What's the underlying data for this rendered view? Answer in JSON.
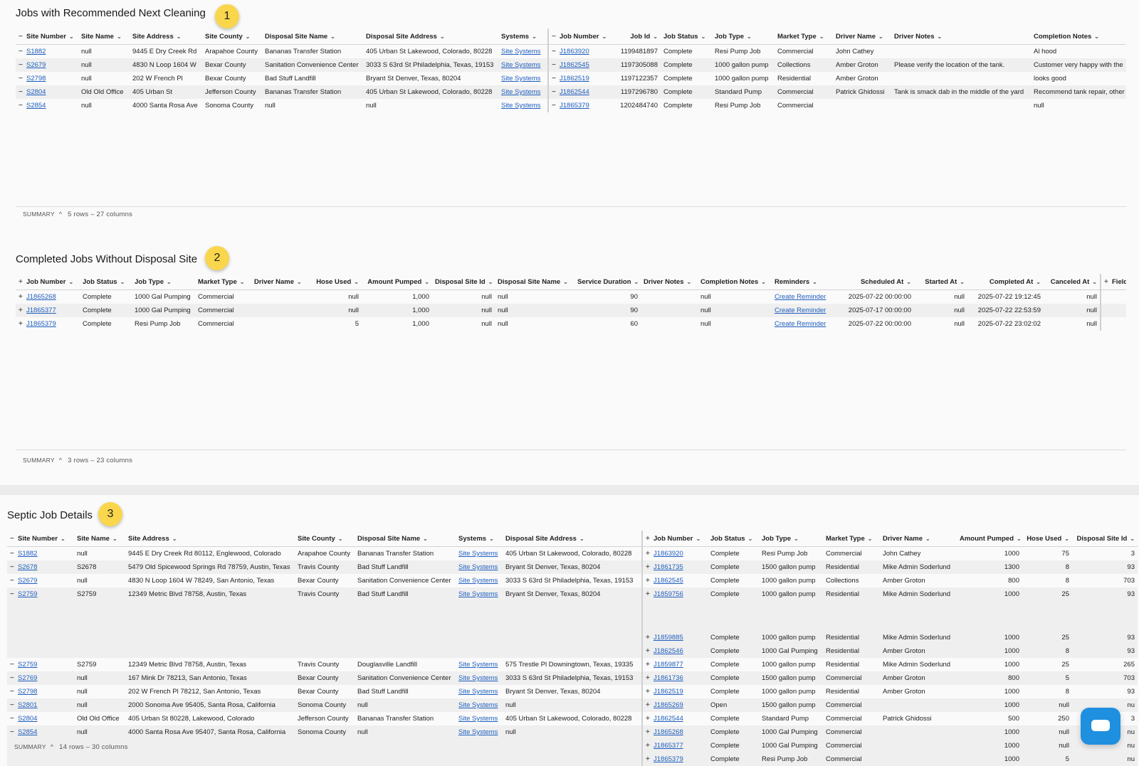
{
  "panels": [
    {
      "title": "Jobs with Recommended Next Cleaning",
      "badge": "1",
      "summary": {
        "label": "SUMMARY",
        "text": "5 rows – 27 columns"
      }
    },
    {
      "title": "Completed Jobs Without Disposal Site",
      "badge": "2",
      "summary": {
        "label": "SUMMARY",
        "text": "3 rows – 23 columns"
      }
    },
    {
      "title": "Septic Job Details",
      "badge": "3",
      "summary": {
        "label": "SUMMARY",
        "text": "14 rows – 30 columns"
      }
    }
  ],
  "table1": {
    "columns": [
      "Site Number",
      "Site Name",
      "Site Address",
      "Site County",
      "Disposal Site Name",
      "Disposal Site Address",
      "Systems",
      "Job Number",
      "Job Id",
      "Job Status",
      "Job Type",
      "Market Type",
      "Driver Name",
      "Driver Notes",
      "Completion Notes"
    ],
    "rows": [
      [
        "S1882",
        "null",
        "9445 E Dry Creek Rd",
        "Arapahoe County",
        "Bananas Transfer Station",
        "405 Urban St Lakewood, Colorado, 80228",
        "Site Systems",
        "J1863920",
        "1199481897",
        "Complete",
        "Resi Pump Job",
        "Commercial",
        "John Cathey",
        "",
        "Al hood"
      ],
      [
        "S2679",
        "null",
        "4830 N Loop 1604 W",
        "Bexar County",
        "Sanitation Convenience Center",
        "3033 S 63rd St Philadelphia, Texas, 19153",
        "Site Systems",
        "J1862545",
        "1197305088",
        "Complete",
        "1000 gallon pump",
        "Collections",
        "Amber Groton",
        "Please verify the location of the tank.",
        "Customer very happy with the"
      ],
      [
        "S2798",
        "null",
        "202 W French Pl",
        "Bexar County",
        "Bad Stuff Landfill",
        "Bryant St Denver, Texas, 80204",
        "Site Systems",
        "J1862519",
        "1197122357",
        "Complete",
        "1000 gallon pump",
        "Residential",
        "Amber Groton",
        "",
        "looks good"
      ],
      [
        "S2804",
        "Old Old Office",
        "405 Urban St",
        "Jefferson County",
        "Bananas Transfer Station",
        "405 Urban St Lakewood, Colorado, 80228",
        "Site Systems",
        "J1862544",
        "1197296780",
        "Complete",
        "Standard Pump",
        "Commercial",
        "Patrick Ghidossi",
        "Tank is smack dab in the middle of the yard",
        "Recommend tank repair, other"
      ],
      [
        "S2854",
        "null",
        "4000 Santa Rosa Ave",
        "Sonoma County",
        "null",
        "null",
        "Site Systems",
        "J1865379",
        "1202484740",
        "Complete",
        "Resi Pump Job",
        "Commercial",
        "",
        "",
        "null"
      ]
    ]
  },
  "table2": {
    "columns": [
      "Job Number",
      "Job Status",
      "Job Type",
      "Market Type",
      "Driver Name",
      "Hose Used",
      "Amount Pumped",
      "Disposal Site Id",
      "Disposal Site Name",
      "Service Duration",
      "Driver Notes",
      "Completion Notes",
      "Reminders",
      "Scheduled At",
      "Started At",
      "Completed At",
      "Canceled At",
      "Field Labe"
    ],
    "rows": [
      [
        "J1865268",
        "Complete",
        "1000 Gal Pumping",
        "Commercial",
        "",
        "null",
        "1,000",
        "null",
        "null",
        "90",
        "",
        "null",
        "Create Reminder",
        "2025-07-22 00:00:00",
        "null",
        "2025-07-22 19:12:45",
        "null",
        ""
      ],
      [
        "J1865377",
        "Complete",
        "1000 Gal Pumping",
        "Commercial",
        "",
        "null",
        "1,000",
        "null",
        "null",
        "90",
        "",
        "null",
        "Create Reminder",
        "2025-07-17 00:00:00",
        "null",
        "2025-07-22 22:53:59",
        "null",
        ""
      ],
      [
        "J1865379",
        "Complete",
        "Resi Pump Job",
        "Commercial",
        "",
        "5",
        "1,000",
        "null",
        "null",
        "60",
        "",
        "null",
        "Create Reminder",
        "2025-07-22 00:00:00",
        "null",
        "2025-07-22 23:02:02",
        "null",
        ""
      ]
    ]
  },
  "table3": {
    "columns": [
      "Site Number",
      "Site Name",
      "Site Address",
      "Site County",
      "Disposal Site Name",
      "Systems",
      "Disposal Site Address",
      "Job Number",
      "Job Status",
      "Job Type",
      "Market Type",
      "Driver Name",
      "Amount Pumped",
      "Hose Used",
      "Disposal Site Id"
    ],
    "rows": [
      [
        "S1882",
        "null",
        "9445 E Dry Creek Rd 80112, Englewood, Colorado",
        "Arapahoe County",
        "Bananas Transfer Station",
        "Site Systems",
        "405 Urban St Lakewood, Colorado, 80228",
        "J1863920",
        "Complete",
        "Resi Pump Job",
        "Commercial",
        "John Cathey",
        "1000",
        "75",
        "3"
      ],
      [
        "S2678",
        "S2678",
        "5479 Old Spicewood Springs Rd 78759, Austin, Texas",
        "Travis County",
        "Bad Stuff Landfill",
        "Site Systems",
        "Bryant St Denver, Texas, 80204",
        "J1861735",
        "Complete",
        "1500 gallon pump",
        "Residential",
        "Mike Admin Soderlund",
        "1300",
        "8",
        "93"
      ],
      [
        "S2679",
        "null",
        "4830 N Loop 1604 W 78249, San Antonio, Texas",
        "Bexar County",
        "Sanitation Convenience Center",
        "Site Systems",
        "3033 S 63rd St Philadelphia, Texas, 19153",
        "J1862545",
        "Complete",
        "1000 gallon pump",
        "Collections",
        "Amber Groton",
        "800",
        "8",
        "703"
      ],
      [
        "S2759",
        "S2759",
        "12349 Metric Blvd 78758, Austin, Texas",
        "Travis County",
        "Bad Stuff Landfill",
        "Site Systems",
        "Bryant St Denver, Texas, 80204",
        "J1859756",
        "Complete",
        "1000 gallon pump",
        "Residential",
        "Mike Admin Soderlund",
        "1000",
        "25",
        "93"
      ],
      [
        "",
        "",
        "",
        "",
        "",
        "",
        "",
        "J1859885",
        "Complete",
        "1000 gallon pump",
        "Residential",
        "Mike Admin Soderlund",
        "1000",
        "25",
        "93"
      ],
      [
        "",
        "",
        "",
        "",
        "",
        "",
        "",
        "J1862546",
        "Complete",
        "1000 Gal Pumping",
        "Residential",
        "Amber Groton",
        "1000",
        "8",
        "93"
      ],
      [
        "S2759",
        "S2759",
        "12349 Metric Blvd 78758, Austin, Texas",
        "Travis County",
        "Douglasville Landfill",
        "Site Systems",
        "575 Trestle Pl Downingtown, Texas, 19335",
        "J1859877",
        "Complete",
        "1000 gallon pump",
        "Residential",
        "Mike Admin Soderlund",
        "1000",
        "25",
        "265"
      ],
      [
        "S2769",
        "null",
        "167 Mink Dr 78213, San Antonio, Texas",
        "Bexar County",
        "Sanitation Convenience Center",
        "Site Systems",
        "3033 S 63rd St Philadelphia, Texas, 19153",
        "J1861736",
        "Complete",
        "1500 gallon pump",
        "Commercial",
        "Amber Groton",
        "800",
        "5",
        "703"
      ],
      [
        "S2798",
        "null",
        "202 W French Pl 78212, San Antonio, Texas",
        "Bexar County",
        "Bad Stuff Landfill",
        "Site Systems",
        "Bryant St Denver, Texas, 80204",
        "J1862519",
        "Complete",
        "1000 gallon pump",
        "Residential",
        "Amber Groton",
        "1000",
        "8",
        "93"
      ],
      [
        "S2801",
        "null",
        "2000 Sonoma Ave 95405, Santa Rosa, California",
        "Sonoma County",
        "null",
        "Site Systems",
        "null",
        "J1865269",
        "Open",
        "1500 gallon pump",
        "Commercial",
        "",
        "1000",
        "null",
        "nu"
      ],
      [
        "S2804",
        "Old Old Office",
        "405 Urban St 80228, Lakewood, Colorado",
        "Jefferson County",
        "Bananas Transfer Station",
        "Site Systems",
        "405 Urban St Lakewood, Colorado, 80228",
        "J1862544",
        "Complete",
        "Standard Pump",
        "Commercial",
        "Patrick Ghidossi",
        "500",
        "250",
        "3"
      ],
      [
        "S2854",
        "null",
        "4000 Santa Rosa Ave 95407, Santa Rosa, California",
        "Sonoma County",
        "null",
        "Site Systems",
        "null",
        "J1865268",
        "Complete",
        "1000 Gal Pumping",
        "Commercial",
        "",
        "1000",
        "null",
        "nu"
      ],
      [
        "",
        "",
        "",
        "",
        "",
        "",
        "",
        "J1865377",
        "Complete",
        "1000 Gal Pumping",
        "Commercial",
        "",
        "1000",
        "null",
        "nu"
      ],
      [
        "",
        "",
        "",
        "",
        "",
        "",
        "",
        "J1865379",
        "Complete",
        "Resi Pump Job",
        "Commercial",
        "",
        "1000",
        "5",
        "nu"
      ]
    ]
  }
}
